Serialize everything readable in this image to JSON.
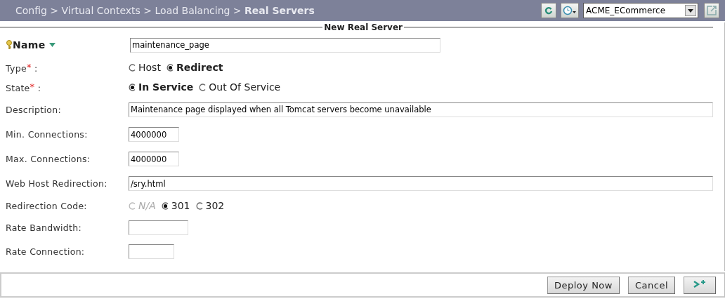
{
  "header": {
    "breadcrumb": "Config > Virtual Contexts > Load Balancing > **Real Servers**",
    "context": "ACME_ECommerce"
  },
  "form": {
    "title": "New Real Server",
    "fields": [
      {
        "kind": "name",
        "label": "Name",
        "value": "maintenance_page"
      },
      {
        "kind": "radio",
        "label": "Type$^{*}$ :",
        "options": [
          {
            "label": "Host",
            "selected": false,
            "disabled": false
          },
          {
            "label": "Redirect",
            "selected": true,
            "disabled": false
          }
        ]
      },
      {
        "kind": "radio",
        "label": "State$^{*}$ :",
        "options": [
          {
            "label": "In Service",
            "selected": true,
            "disabled": false
          },
          {
            "label": "Out Of Service",
            "selected": false,
            "disabled": false
          }
        ]
      },
      {
        "kind": "text",
        "label": "Description:",
        "value": "Maintenance page displayed when all Tomcat servers become unavailable"
      },
      {
        "kind": "text",
        "label": "Min. Connections:",
        "value": "4000000"
      },
      {
        "kind": "text",
        "label": "Max. Connections:",
        "value": "4000000"
      },
      {
        "kind": "text",
        "label": "Web Host Redirection:",
        "value": "/sry.html"
      },
      {
        "kind": "radio",
        "label": "Redirection Code:",
        "options": [
          {
            "label": "N/A",
            "selected": false,
            "disabled": true
          },
          {
            "label": "301",
            "selected": true,
            "disabled": false
          },
          {
            "label": "302",
            "selected": false,
            "disabled": false
          }
        ]
      },
      {
        "kind": "text",
        "label": "Rate Bandwidth:"
      },
      {
        "kind": "text",
        "label": "Rate Connection:"
      }
    ]
  },
  "buttons": [
    "Deploy Now",
    "Cancel"
  ]
}
